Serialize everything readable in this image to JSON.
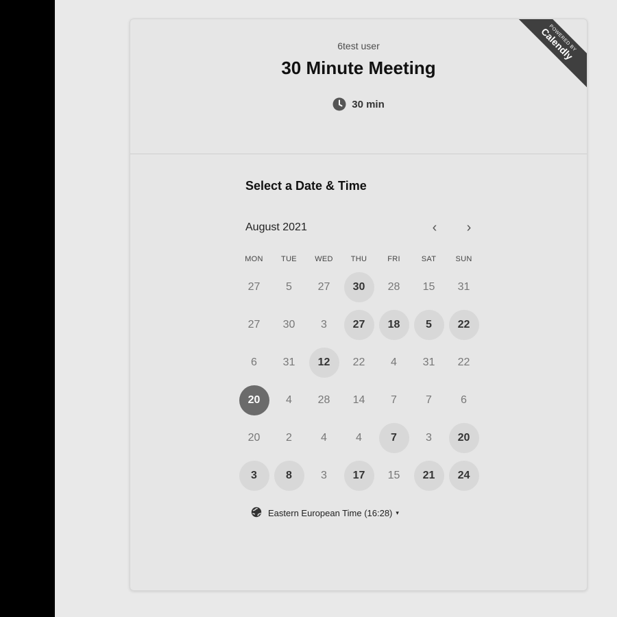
{
  "header": {
    "owner": "6test user",
    "title": "30 Minute Meeting",
    "duration": "30 min",
    "ribbon_small": "POWERED BY",
    "ribbon_brand": "Calendly"
  },
  "calendar": {
    "section_title": "Select a Date & Time",
    "month": "August 2021",
    "prev_icon": "‹",
    "next_icon": "›",
    "weekdays": [
      "MON",
      "TUE",
      "WED",
      "THU",
      "FRI",
      "SAT",
      "SUN"
    ],
    "days": [
      {
        "label": "27",
        "state": "default"
      },
      {
        "label": "5",
        "state": "default"
      },
      {
        "label": "27",
        "state": "default"
      },
      {
        "label": "30",
        "state": "available"
      },
      {
        "label": "28",
        "state": "default"
      },
      {
        "label": "15",
        "state": "default"
      },
      {
        "label": "31",
        "state": "default"
      },
      {
        "label": "27",
        "state": "default"
      },
      {
        "label": "30",
        "state": "default"
      },
      {
        "label": "3",
        "state": "default"
      },
      {
        "label": "27",
        "state": "available"
      },
      {
        "label": "18",
        "state": "available"
      },
      {
        "label": "5",
        "state": "available"
      },
      {
        "label": "22",
        "state": "available"
      },
      {
        "label": "6",
        "state": "default"
      },
      {
        "label": "31",
        "state": "default"
      },
      {
        "label": "12",
        "state": "available"
      },
      {
        "label": "22",
        "state": "default"
      },
      {
        "label": "4",
        "state": "default"
      },
      {
        "label": "31",
        "state": "default"
      },
      {
        "label": "22",
        "state": "default"
      },
      {
        "label": "20",
        "state": "selected"
      },
      {
        "label": "4",
        "state": "default"
      },
      {
        "label": "28",
        "state": "default"
      },
      {
        "label": "14",
        "state": "default"
      },
      {
        "label": "7",
        "state": "default"
      },
      {
        "label": "7",
        "state": "default"
      },
      {
        "label": "6",
        "state": "default"
      },
      {
        "label": "20",
        "state": "default"
      },
      {
        "label": "2",
        "state": "default"
      },
      {
        "label": "4",
        "state": "default"
      },
      {
        "label": "4",
        "state": "default"
      },
      {
        "label": "7",
        "state": "available"
      },
      {
        "label": "3",
        "state": "default"
      },
      {
        "label": "20",
        "state": "available"
      },
      {
        "label": "3",
        "state": "available"
      },
      {
        "label": "8",
        "state": "available"
      },
      {
        "label": "3",
        "state": "default"
      },
      {
        "label": "17",
        "state": "available"
      },
      {
        "label": "15",
        "state": "default"
      },
      {
        "label": "21",
        "state": "available"
      },
      {
        "label": "24",
        "state": "available"
      }
    ]
  },
  "timezone": {
    "label": "Eastern European Time (16:28)",
    "caret": "▾",
    "icon": "globe-icon"
  },
  "colors": {
    "selected_bg": "#6b6b6b",
    "available_bg": "#d8d8d8",
    "ribbon_bg": "#3f3f3f"
  }
}
